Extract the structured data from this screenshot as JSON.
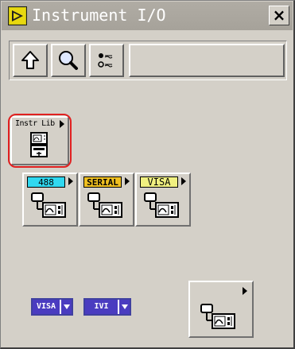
{
  "window": {
    "title": "Instrument I/O",
    "close_label": "×"
  },
  "toolbar": {
    "buttons": [
      {
        "name": "up-arrow-icon"
      },
      {
        "name": "search-icon"
      },
      {
        "name": "options-icon"
      }
    ]
  },
  "palette": {
    "instr_lib": {
      "label": "Instr Lib"
    },
    "gpib": {
      "label": "488",
      "color": "#30d8f0"
    },
    "serial": {
      "label": "SERIAL",
      "color": "#f0c020"
    },
    "visa": {
      "label": "VISA",
      "color": "#f0f080"
    },
    "visa_ring": {
      "label": "VISA"
    },
    "ivi_ring": {
      "label": "IVI"
    }
  },
  "colors": {
    "highlight": "#e02020",
    "ring": "#4a3cc0",
    "window_bg": "#d4d0c8"
  }
}
